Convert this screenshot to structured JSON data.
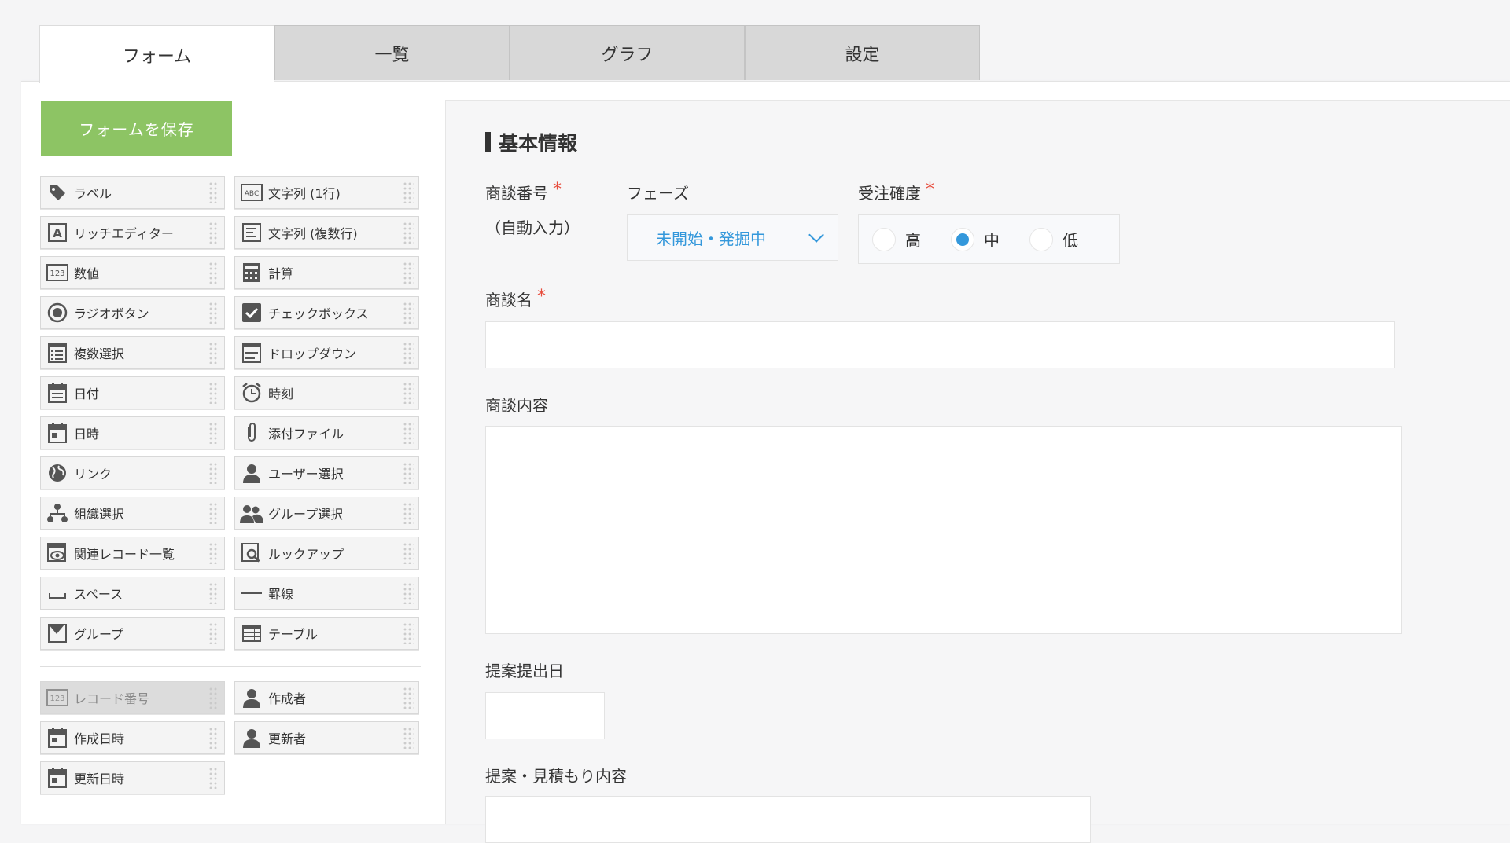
{
  "tabs": [
    {
      "label": "フォーム"
    },
    {
      "label": "一覧"
    },
    {
      "label": "グラフ"
    },
    {
      "label": "設定"
    }
  ],
  "save_button": {
    "label": "フォームを保存"
  },
  "palette": {
    "fields": [
      {
        "label": "ラベル",
        "icon": "tag-icon"
      },
      {
        "label": "文字列 (1行)",
        "icon": "text-abc-icon"
      },
      {
        "label": "リッチエディター",
        "icon": "rich-text-icon"
      },
      {
        "label": "文字列 (複数行)",
        "icon": "multiline-text-icon"
      },
      {
        "label": "数値",
        "icon": "number-icon"
      },
      {
        "label": "計算",
        "icon": "calculator-icon"
      },
      {
        "label": "ラジオボタン",
        "icon": "radio-icon"
      },
      {
        "label": "チェックボックス",
        "icon": "checkbox-icon"
      },
      {
        "label": "複数選択",
        "icon": "multiselect-icon"
      },
      {
        "label": "ドロップダウン",
        "icon": "dropdown-icon"
      },
      {
        "label": "日付",
        "icon": "date-icon"
      },
      {
        "label": "時刻",
        "icon": "clock-icon"
      },
      {
        "label": "日時",
        "icon": "datetime-icon"
      },
      {
        "label": "添付ファイル",
        "icon": "paperclip-icon"
      },
      {
        "label": "リンク",
        "icon": "globe-icon"
      },
      {
        "label": "ユーザー選択",
        "icon": "user-icon"
      },
      {
        "label": "組織選択",
        "icon": "org-icon"
      },
      {
        "label": "グループ選択",
        "icon": "group-icon"
      },
      {
        "label": "関連レコード一覧",
        "icon": "related-records-icon"
      },
      {
        "label": "ルックアップ",
        "icon": "lookup-icon"
      },
      {
        "label": "スペース",
        "icon": "space-icon"
      },
      {
        "label": "罫線",
        "icon": "line-icon"
      },
      {
        "label": "グループ",
        "icon": "group-field-icon"
      },
      {
        "label": "テーブル",
        "icon": "table-icon"
      }
    ],
    "system_fields": [
      {
        "label": "レコード番号",
        "icon": "number-icon",
        "disabled": true
      },
      {
        "label": "作成者",
        "icon": "user-icon"
      },
      {
        "label": "作成日時",
        "icon": "datetime-icon"
      },
      {
        "label": "更新者",
        "icon": "user-icon"
      },
      {
        "label": "更新日時",
        "icon": "datetime-icon"
      }
    ]
  },
  "form": {
    "section_title": "基本情報",
    "deal_number": {
      "label": "商談番号",
      "value": "（自動入力）"
    },
    "phase": {
      "label": "フェーズ",
      "value": "未開始・発掘中"
    },
    "probability": {
      "label": "受注確度",
      "options": [
        {
          "label": "高",
          "selected": false
        },
        {
          "label": "中",
          "selected": true
        },
        {
          "label": "低",
          "selected": false
        }
      ]
    },
    "deal_name": {
      "label": "商談名"
    },
    "deal_content": {
      "label": "商談内容"
    },
    "proposal_date": {
      "label": "提案提出日"
    },
    "proposal_content": {
      "label": "提案・見積もり内容"
    }
  },
  "colors": {
    "save_button": "#8dc464",
    "accent": "#3498db",
    "required": "#e74c3c"
  }
}
